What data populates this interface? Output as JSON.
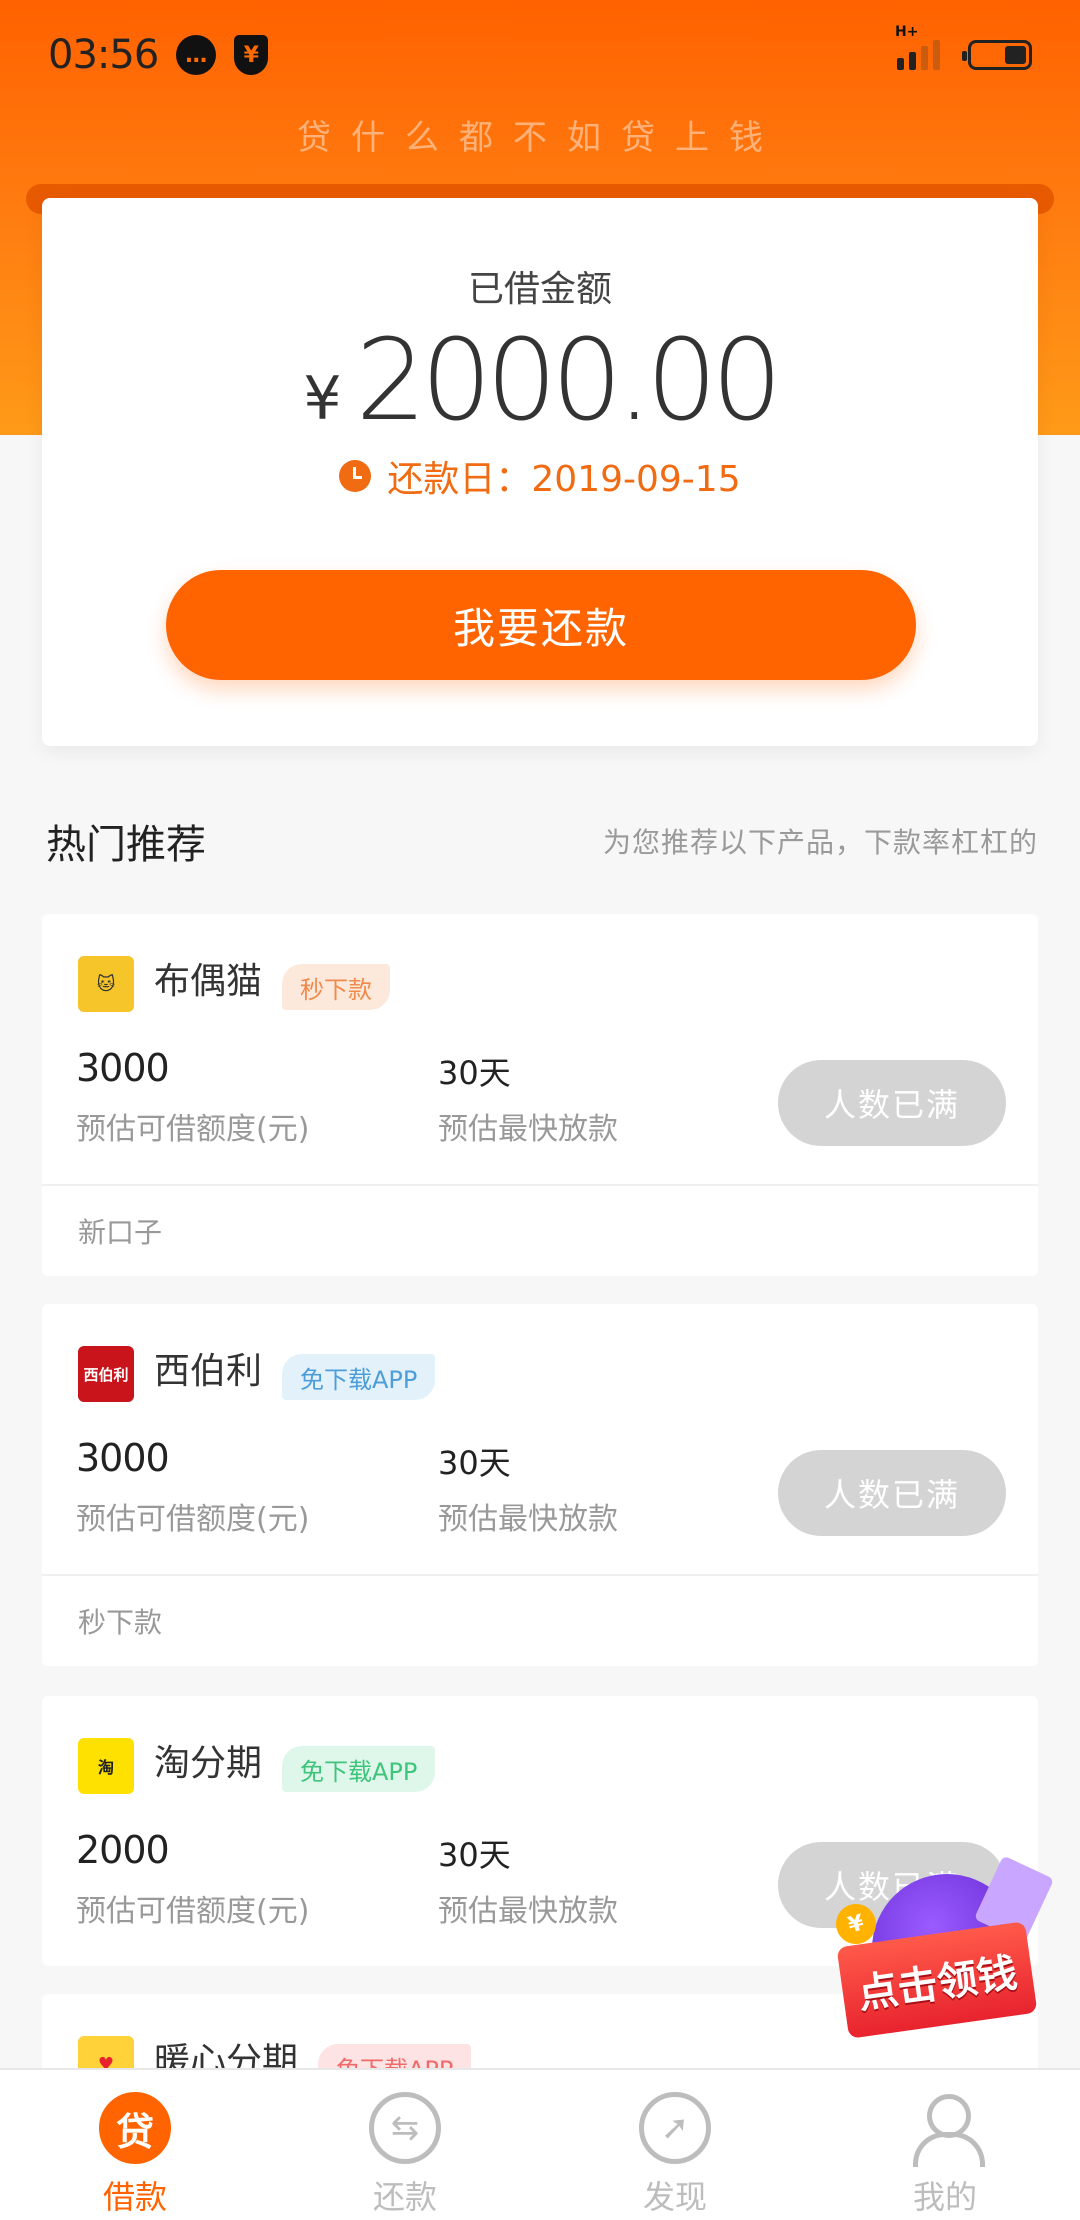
{
  "status_bar": {
    "time": "03:56",
    "icons": [
      "message-icon",
      "yuan-shield-icon",
      "signal-icon",
      "battery-icon"
    ],
    "network": "H+",
    "battery_level": 0.4
  },
  "header": {
    "slogan": "贷什么都不如贷上钱"
  },
  "loan_card": {
    "label": "已借金额",
    "currency": "¥",
    "amount": "2000.00",
    "due_label": "还款日：2019-09-15",
    "repay_button": "我要还款"
  },
  "recommend": {
    "title": "热门推荐",
    "subtitle": "为您推荐以下产品，下款率杠杠的",
    "products": [
      {
        "name": "布偶猫",
        "tag": "秒下款",
        "amount": "3000",
        "amount_label": "预估可借额度(元)",
        "days": "30天",
        "days_label": "预估最快放款",
        "button": "人数已满",
        "note": "新口子"
      },
      {
        "name": "西伯利",
        "tag": "免下载APP",
        "logo_text": "西伯利",
        "amount": "3000",
        "amount_label": "预估可借额度(元)",
        "days": "30天",
        "days_label": "预估最快放款",
        "button": "人数已满",
        "note": "秒下款"
      },
      {
        "name": "淘分期",
        "tag": "免下载APP",
        "amount": "2000",
        "amount_label": "预估可借额度(元)",
        "days": "30天",
        "days_label": "预估最快放款",
        "button": "人数已满"
      },
      {
        "name": "暖心分期",
        "tag": "免下载APP"
      }
    ]
  },
  "promo": {
    "label": "点击领钱",
    "coin": "¥"
  },
  "tabbar": {
    "items": [
      {
        "label": "借款",
        "icon_text": "贷",
        "active": true
      },
      {
        "label": "还款"
      },
      {
        "label": "发现"
      },
      {
        "label": "我的"
      }
    ]
  },
  "colors": {
    "brand": "#ff6400",
    "due_text": "#f06b12",
    "disabled_button": "#d4d4d4"
  }
}
